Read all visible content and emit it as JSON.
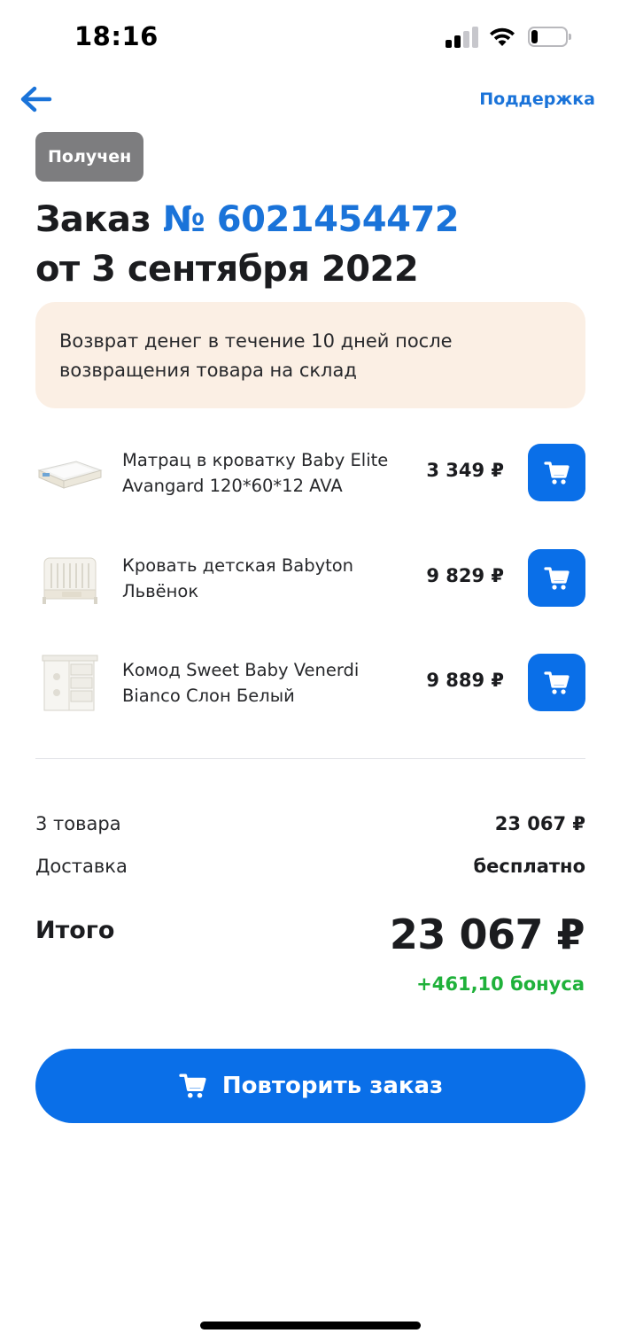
{
  "status_bar": {
    "time": "18:16",
    "battery_level": 0.2
  },
  "header": {
    "back_icon": "arrow-left-icon",
    "support_label": "Поддержка"
  },
  "order": {
    "status": "Получен",
    "title_prefix": "Заказ",
    "number": "№ 6021454472",
    "date_line": "от 3 сентября 2022"
  },
  "notice": {
    "text": "Возврат денег в течение 10 дней после возвращения товара на склад"
  },
  "items": [
    {
      "name": "Матрац в кроватку Baby Elite Avangard 120*60*12 AVA",
      "price": "3 349 ₽",
      "thumb": "mattress-image",
      "cart_icon": "cart-icon"
    },
    {
      "name": "Кровать детская Babyton Львёнок",
      "price": "9 829 ₽",
      "thumb": "crib-image",
      "cart_icon": "cart-icon"
    },
    {
      "name": "Комод Sweet Baby Venerdi Bianco Слон Белый",
      "price": "9 889 ₽",
      "thumb": "dresser-image",
      "cart_icon": "cart-icon"
    }
  ],
  "summary": {
    "items_label": "3 товара",
    "items_value": "23 067 ₽",
    "delivery_label": "Доставка",
    "delivery_value": "бесплатно",
    "total_label": "Итого",
    "total_value": "23 067 ₽",
    "bonus": "+461,10 бонуса"
  },
  "actions": {
    "repeat_label": "Повторить заказ"
  },
  "colors": {
    "accent": "#0a6fe8",
    "link": "#1a73d9",
    "badge": "#7d7d7f",
    "notice_bg": "#fbefe4",
    "bonus": "#1fb13a"
  }
}
